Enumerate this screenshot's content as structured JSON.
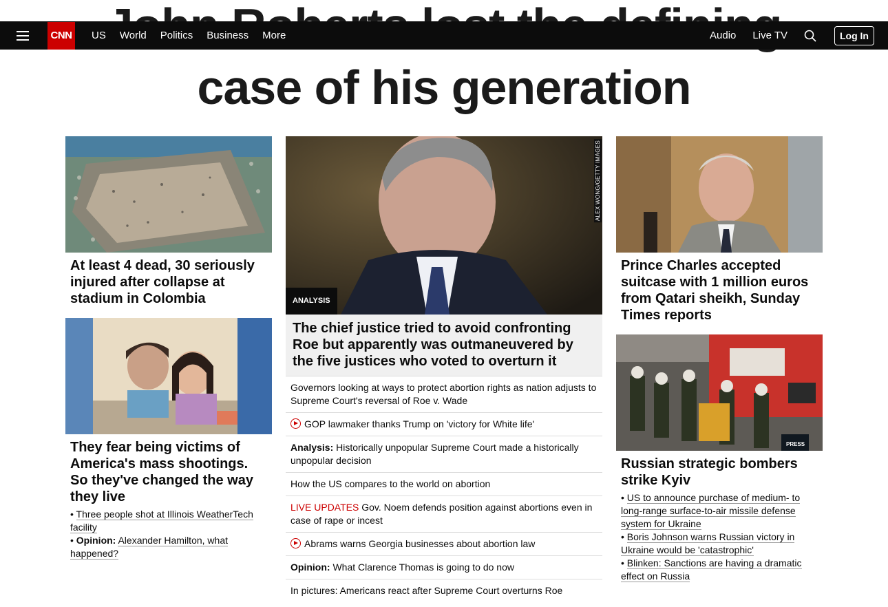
{
  "headline": {
    "line1": "John Roberts lost the defining",
    "line2": "case of his generation"
  },
  "nav": {
    "logo": "CNN",
    "links": [
      "US",
      "World",
      "Politics",
      "Business",
      "More"
    ],
    "audio": "Audio",
    "live_tv": "Live TV",
    "login": "Log In"
  },
  "left": {
    "story1": {
      "title": "At least 4 dead, 30 seriously injured after collapse at stadium in Colombia"
    },
    "story2": {
      "title": "They fear being victims of America's mass shootings. So they've changed the way they live",
      "bullet1": "Three people shot at Illinois WeatherTech facility",
      "bullet2_label": "Opinion:",
      "bullet2_text": "Alexander Hamilton, what happened?"
    }
  },
  "middle": {
    "tag": "ANALYSIS",
    "credit": "ALEX WONG/GETTY IMAGES",
    "title": "The chief justice tried to avoid confronting Roe but apparently was outmaneuvered by the five justices who voted to overturn it",
    "items": {
      "i1": "Governors looking at ways to protect abortion rights as nation adjusts to Supreme Court's reversal of Roe v. Wade",
      "i2": "GOP lawmaker thanks Trump on 'victory for White life'",
      "i3_label": "Analysis:",
      "i3_text": "Historically unpopular Supreme Court made a historically unpopular decision",
      "i4": "How the US compares to the world on abortion",
      "i5_label": "LIVE UPDATES",
      "i5_text": "Gov. Noem defends position against abortions even in case of rape or incest",
      "i6": "Abrams warns Georgia businesses about abortion law",
      "i7_label": "Opinion:",
      "i7_text": "What Clarence Thomas is going to do now",
      "i8": "In pictures: Americans react after Supreme Court overturns Roe"
    }
  },
  "right": {
    "story1": {
      "title": "Prince Charles accepted suitcase with 1 million euros from Qatari sheikh, Sunday Times reports"
    },
    "story2": {
      "title": "Russian strategic bombers strike Kyiv",
      "bullet1": "US to announce purchase of medium- to long-range surface-to-air missile defense system for Ukraine",
      "bullet2": "Boris Johnson warns Russian victory in Ukraine would be 'catastrophic'",
      "bullet3": "Blinken: Sanctions are having a dramatic effect on Russia",
      "press_label": "PRESS"
    }
  },
  "colors": {
    "nav_bg": "#0c0c0c",
    "brand_red": "#cc0000",
    "live_red": "#cc0000"
  }
}
